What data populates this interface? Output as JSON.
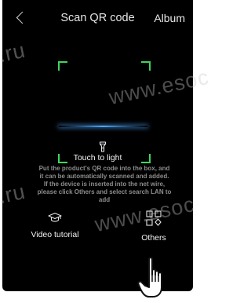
{
  "header": {
    "title": "Scan QR code",
    "album_label": "Album"
  },
  "scanner": {
    "torch_label": "Touch to light",
    "instructions": "Put the product's QR code into the box, and it can be automatically scanned and added. If the device is inserted into the net wire, please click Others  and select search LAN to add"
  },
  "bottom": {
    "tutorial_label": "Video tutorial",
    "others_label": "Others"
  },
  "watermarks": [
    ".ru",
    "www.esoc",
    ".ru",
    "www.esoc"
  ],
  "colors": {
    "frame_corner": "#3ed65c",
    "scan_line": "#4fa7ff",
    "background": "#000000"
  },
  "icons": [
    "back-chevron-icon",
    "flashlight-icon",
    "graduation-cap-icon",
    "others-grid-icon",
    "pointing-hand-icon"
  ]
}
